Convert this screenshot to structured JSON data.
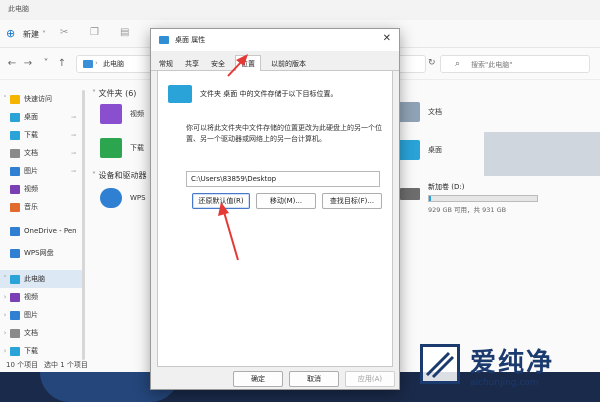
{
  "explorer": {
    "title": "此电脑",
    "toolbar": {
      "new_label": "新建"
    },
    "address": "此电脑",
    "search_placeholder": "搜索\"此电脑\"",
    "sidebar": [
      {
        "label": "快速访问",
        "chev": "˅",
        "color": "#f4b400"
      },
      {
        "label": "桌面",
        "chev": "",
        "color": "#2aa3d8",
        "pin": "📌"
      },
      {
        "label": "下载",
        "chev": "",
        "color": "#2aa3d8",
        "pin": "📌"
      },
      {
        "label": "文档",
        "chev": "",
        "color": "#8a8a8a",
        "pin": "📌"
      },
      {
        "label": "图片",
        "chev": "",
        "color": "#2f7fd2",
        "pin": "📌"
      },
      {
        "label": "视频",
        "chev": "",
        "color": "#7a3fb5"
      },
      {
        "label": "音乐",
        "chev": "",
        "color": "#e36a2e"
      },
      {
        "label": "OneDrive - Pen",
        "chev": "",
        "color": "#2f7fd2"
      },
      {
        "label": "WPS网盘",
        "chev": "",
        "color": "#2f7fd2"
      },
      {
        "label": "此电脑",
        "chev": "˅",
        "color": "#2aa3d8",
        "selected": true
      },
      {
        "label": "视频",
        "chev": "›",
        "color": "#7a3fb5"
      },
      {
        "label": "图片",
        "chev": "›",
        "color": "#2f7fd2"
      },
      {
        "label": "文档",
        "chev": "›",
        "color": "#8a8a8a"
      },
      {
        "label": "下载",
        "chev": "›",
        "color": "#2aa3d8"
      }
    ],
    "groups": {
      "folders": "文件夹 (6)",
      "devices": "设备和驱动器"
    },
    "tiles": {
      "video": "视频",
      "download": "下载",
      "documents": "文档",
      "desktop": "桌面",
      "wps": "WPS"
    },
    "drive": {
      "name": "新加卷 (D:)",
      "free": "929 GB 可用，共 931 GB",
      "used_fraction": 0.02
    },
    "status": {
      "count": "10 个项目",
      "selected": "选中 1 个项目"
    }
  },
  "dialog": {
    "title": "桌面 属性",
    "close": "✕",
    "tabs": [
      "常规",
      "共享",
      "安全",
      "位置",
      "以前的版本"
    ],
    "active_tab": "位置",
    "line1": "文件夹 桌面 中的文件存储于以下目标位置。",
    "description": "你可以将此文件夹中文件存储的位置更改为此硬盘上的另一个位置、另一个驱动器或网络上的另一台计算机。",
    "path": "C:\\Users\\83859\\Desktop",
    "buttons": {
      "restore": "还原默认值(R)",
      "move": "移动(M)...",
      "find": "查找目标(F)..."
    },
    "footer": {
      "ok": "确定",
      "cancel": "取消",
      "apply": "应用(A)"
    }
  },
  "watermark": {
    "cn": "爱纯净",
    "en": "aichunjing.com"
  },
  "colors": {
    "accent": "#2aa3d8",
    "arrow": "#e53935",
    "brand": "#1b3a6e"
  }
}
